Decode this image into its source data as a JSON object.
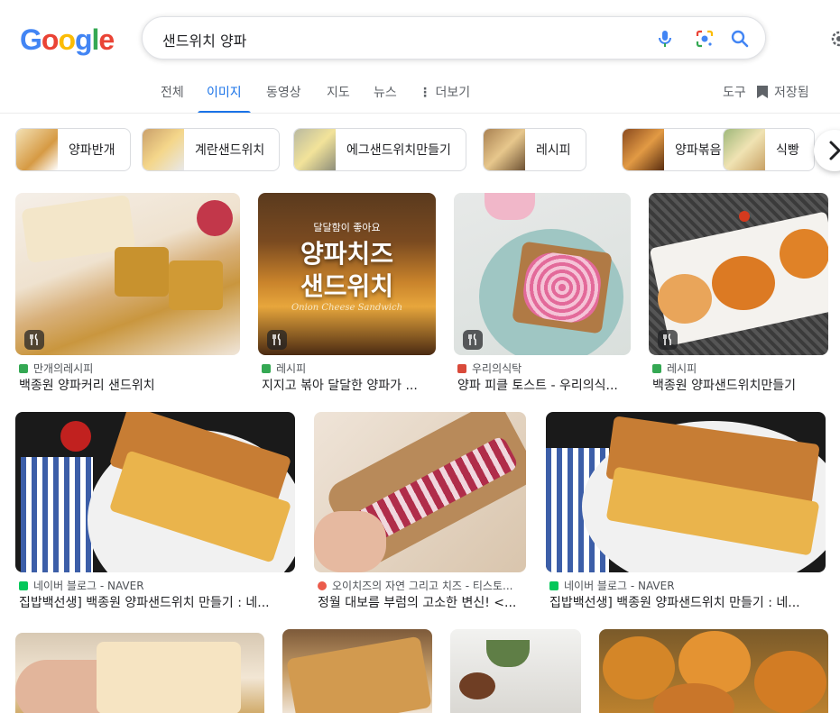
{
  "logo": {
    "letters": [
      "G",
      "o",
      "o",
      "g",
      "l",
      "e"
    ],
    "colors": [
      "#4285F4",
      "#EA4335",
      "#FBBC05",
      "#4285F4",
      "#34A853",
      "#EA4335"
    ]
  },
  "search": {
    "query": "샌드위치 양파"
  },
  "icons": {
    "mic": "mic-icon",
    "lens": "camera-lens-icon",
    "search": "search-icon",
    "settings": "gear-icon"
  },
  "tabs": [
    "전체",
    "이미지",
    "동영상",
    "지도",
    "뉴스",
    "더보기"
  ],
  "active_tab": "이미지",
  "tools": {
    "tools_label": "도구",
    "saved_label": "저장됨"
  },
  "chips": [
    "양파반개",
    "계란샌드위치",
    "에그샌드위치만들기",
    "레시피",
    "양파볶음",
    "식빵"
  ],
  "results": [
    {
      "source": "만개의레시피",
      "title": "백종원 양파커리 샌드위치",
      "favicon": "#34A853",
      "badge": "recipe-icon"
    },
    {
      "source": "레시피",
      "title": "지지고 볶아 달달한 양파가 ...",
      "favicon": "#34A853",
      "badge": "recipe-icon",
      "overlay_lines": [
        "달달함이 좋아요",
        "양파치즈",
        "샌드위치",
        "Onion Cheese Sandwich"
      ]
    },
    {
      "source": "우리의식탁",
      "title": "양파 피클 토스트 - 우리의식...",
      "favicon": "#d94a3a",
      "badge": "recipe-icon"
    },
    {
      "source": "레시피",
      "title": "백종원 양파샌드위치만들기",
      "favicon": "#34A853",
      "badge": "recipe-icon"
    },
    {
      "source": "네이버 블로그 - NAVER",
      "title": "집밥백선생] 백종원 양파샌드위치 만들기 : 네...",
      "favicon": "#03C75A"
    },
    {
      "source": "오이치즈의 자연 그리고 치즈 - 티스토...",
      "title": "정월 대보름 부럼의 고소한 변신! <...",
      "favicon": "#EB5B4B"
    },
    {
      "source": "네이버 블로그 - NAVER",
      "title": "집밥백선생] 백종원 양파샌드위치 만들기 : 네...",
      "favicon": "#03C75A"
    },
    {
      "source": "",
      "title": "",
      "favicon": ""
    },
    {
      "source": "",
      "title": "",
      "favicon": ""
    },
    {
      "source": "",
      "title": "",
      "favicon": ""
    },
    {
      "source": "",
      "title": "",
      "favicon": ""
    }
  ]
}
